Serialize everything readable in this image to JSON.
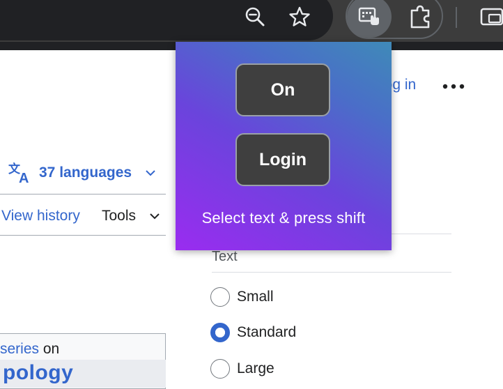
{
  "browser": {
    "toolbar_icons": [
      "zoom-out-icon",
      "star-icon",
      "extension-active-icon",
      "puzzle-icon",
      "split-view-icon"
    ]
  },
  "page": {
    "login_link": "Log in",
    "languages_label": "37 languages",
    "tabs": {
      "view_history": "View history",
      "tools": "Tools"
    },
    "appearance": {
      "text_heading": "Text",
      "sizes": [
        {
          "label": "Small",
          "checked": false
        },
        {
          "label": "Standard",
          "checked": true
        },
        {
          "label": "Large",
          "checked": false
        }
      ]
    },
    "infobox": {
      "series_link": "series",
      "series_suffix": " on",
      "title_fragment": "pology"
    }
  },
  "popup": {
    "on_label": "On",
    "login_label": "Login",
    "hint": "Select text & press shift"
  },
  "colors": {
    "toolbar": "#3c3c3c",
    "link": "#3366cc",
    "popup_gradient_start": "#9a2cf0",
    "popup_gradient_end": "#3f8ab8",
    "popup_button": "#3f3f3f"
  }
}
